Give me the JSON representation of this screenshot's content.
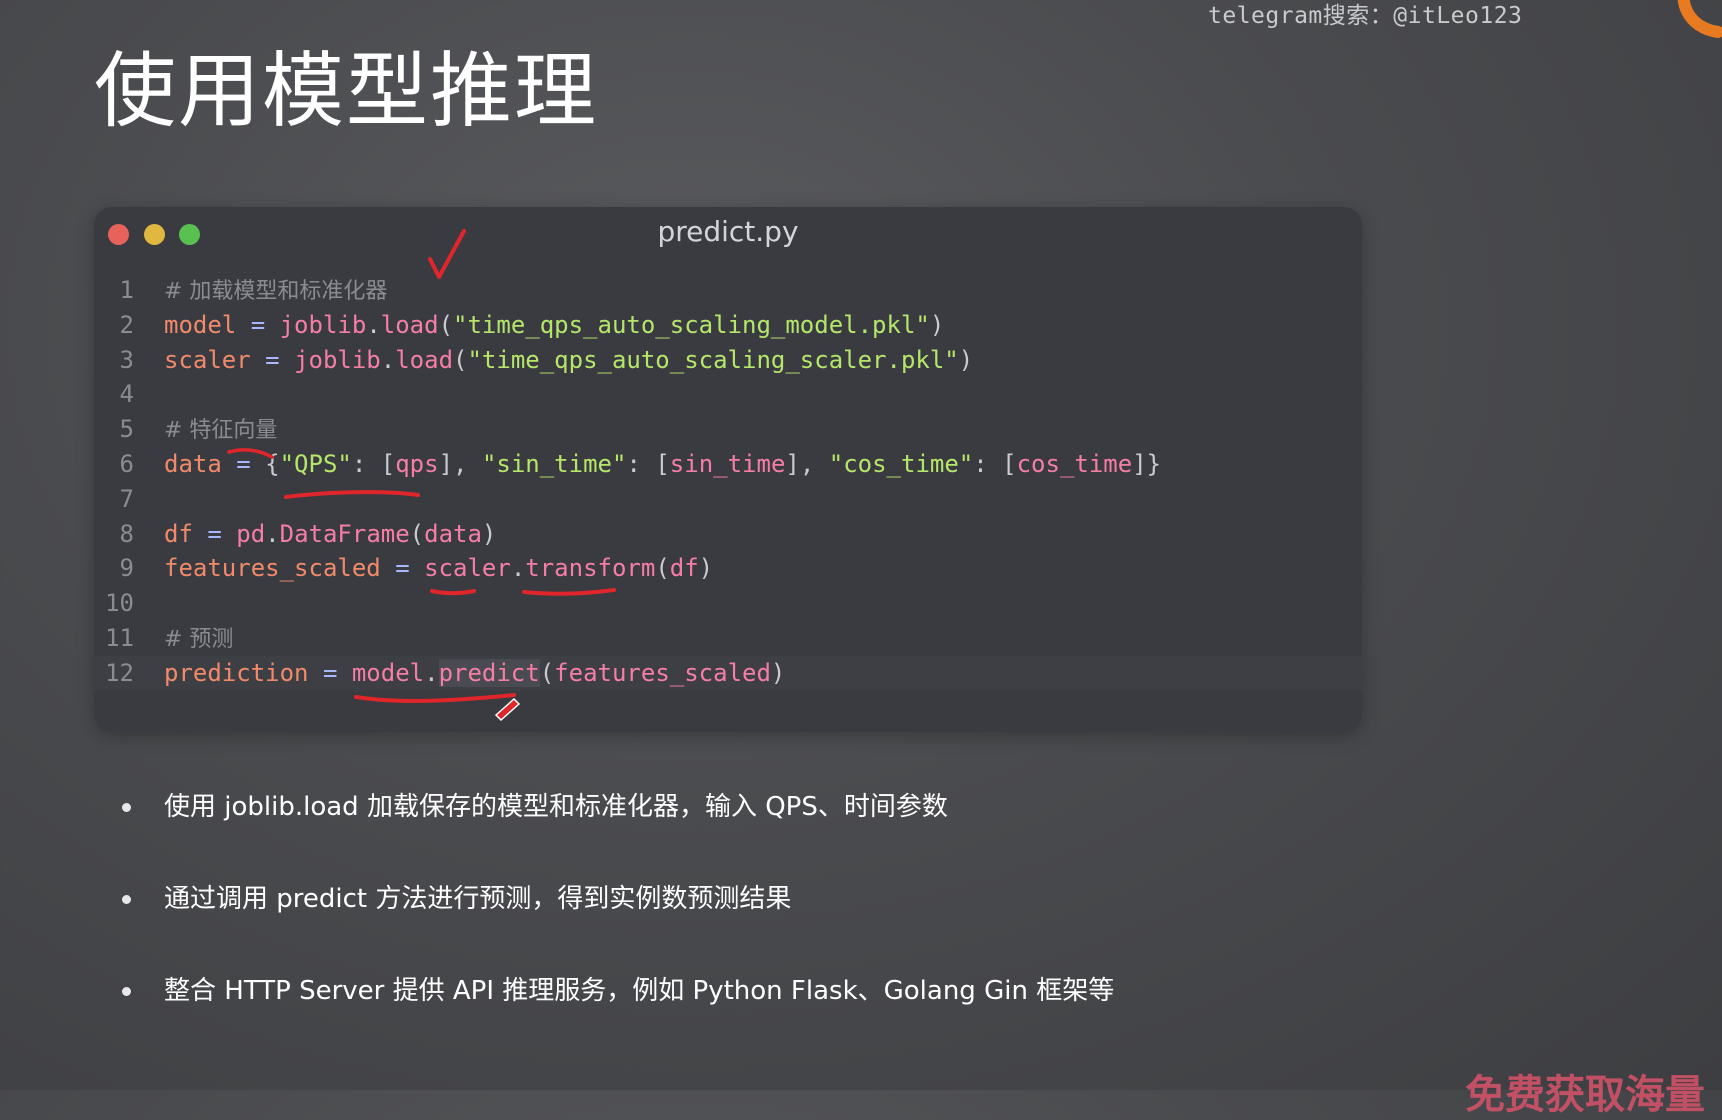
{
  "watermark": "telegram搜索：@itLeo123",
  "slide_title": "使用模型推理",
  "window": {
    "filename": "predict.py"
  },
  "code": {
    "line_numbers": [
      "1",
      "2",
      "3",
      "4",
      "5",
      "6",
      "7",
      "8",
      "9",
      "10",
      "11",
      "12"
    ],
    "lines": {
      "l1": {
        "comment": "# 加载模型和标准化器"
      },
      "l2": {
        "var": "model",
        "eq": " = ",
        "obj": "joblib",
        "dot": ".",
        "method": "load",
        "open": "(",
        "str": "\"time_qps_auto_scaling_model.pkl\"",
        "close": ")"
      },
      "l3": {
        "var": "scaler",
        "eq": " = ",
        "obj": "joblib",
        "dot": ".",
        "method": "load",
        "open": "(",
        "str": "\"time_qps_auto_scaling_scaler.pkl\"",
        "close": ")"
      },
      "l5": {
        "comment": "# 特征向量"
      },
      "l6": {
        "var": "data",
        "eq": " = ",
        "brace_open": "{",
        "k1": "\"QPS\"",
        "c1": ": [",
        "v1": "qps",
        "s1": "], ",
        "k2": "\"sin_time\"",
        "c2": ": [",
        "v2": "sin_time",
        "s2": "], ",
        "k3": "\"cos_time\"",
        "c3": ": [",
        "v3": "cos_time",
        "s3": "]}"
      },
      "l8": {
        "var": "df",
        "eq": " = ",
        "obj": "pd",
        "dot": ".",
        "method": "DataFrame",
        "open": "(",
        "arg": "data",
        "close": ")"
      },
      "l9": {
        "var": "features_scaled",
        "eq": " = ",
        "obj": "scaler",
        "dot": ".",
        "method": "transform",
        "open": "(",
        "arg": "df",
        "close": ")"
      },
      "l11": {
        "comment": "# 预测"
      },
      "l12": {
        "var": "prediction",
        "eq": " = ",
        "obj": "model",
        "dot": ".",
        "method": "predict",
        "open": "(",
        "arg": "features_scaled",
        "close": ")"
      }
    }
  },
  "bullets": [
    "使用 joblib.load 加载保存的模型和标准化器，输入 QPS、时间参数",
    "通过调用 predict 方法进行预测，得到实例数预测结果",
    "整合 HTTP Server 提供 API 推理服务，例如 Python Flask、Golang Gin 框架等"
  ],
  "bottom_watermark": "免费获取海量",
  "colors": {
    "background": "#4a4b4e",
    "code_window": "#3a3b41",
    "annotation": "#e0262a"
  }
}
